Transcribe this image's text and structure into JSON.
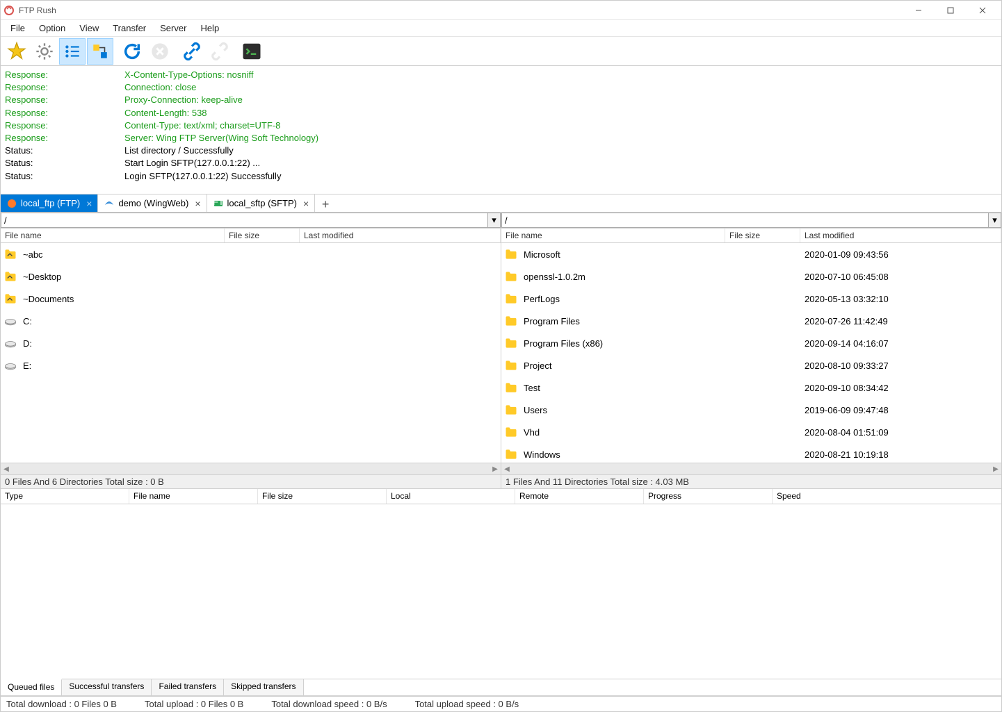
{
  "window": {
    "title": "FTP Rush"
  },
  "menu": [
    "File",
    "Option",
    "View",
    "Transfer",
    "Server",
    "Help"
  ],
  "log_lines": [
    {
      "cls": "green",
      "label": "Response:",
      "msg": "X-Content-Type-Options: nosniff"
    },
    {
      "cls": "green",
      "label": "Response:",
      "msg": "Connection: close"
    },
    {
      "cls": "green",
      "label": "Response:",
      "msg": "Proxy-Connection: keep-alive"
    },
    {
      "cls": "green",
      "label": "Response:",
      "msg": "Content-Length: 538"
    },
    {
      "cls": "green",
      "label": "Response:",
      "msg": "Content-Type: text/xml; charset=UTF-8"
    },
    {
      "cls": "green",
      "label": "Response:",
      "msg": "Server: Wing FTP Server(Wing Soft Technology)"
    },
    {
      "cls": "black",
      "label": "Status:",
      "msg": "List directory / Successfully"
    },
    {
      "cls": "black",
      "label": "Status:",
      "msg": "Start Login SFTP(127.0.0.1:22) ..."
    },
    {
      "cls": "black",
      "label": "Status:",
      "msg": "Login SFTP(127.0.0.1:22) Successfully"
    }
  ],
  "conn_tabs": {
    "items": [
      {
        "label": "local_ftp (FTP)",
        "active": true,
        "icon": "ftp"
      },
      {
        "label": "demo (WingWeb)",
        "active": false,
        "icon": "wing"
      },
      {
        "label": "local_sftp (SFTP)",
        "active": false,
        "icon": "sftp"
      }
    ]
  },
  "left_pane": {
    "path": "/",
    "headers": {
      "name": "File name",
      "size": "File size",
      "mod": "Last modified"
    },
    "rows": [
      {
        "icon": "link-folder",
        "name": "~abc",
        "size": "",
        "mod": ""
      },
      {
        "icon": "link-folder",
        "name": "~Desktop",
        "size": "",
        "mod": ""
      },
      {
        "icon": "link-folder",
        "name": "~Documents",
        "size": "",
        "mod": ""
      },
      {
        "icon": "drive",
        "name": "C:",
        "size": "",
        "mod": ""
      },
      {
        "icon": "drive",
        "name": "D:",
        "size": "",
        "mod": ""
      },
      {
        "icon": "drive",
        "name": "E:",
        "size": "",
        "mod": ""
      }
    ],
    "footer": "0 Files And 6 Directories Total size : 0 B"
  },
  "right_pane": {
    "path": "/",
    "headers": {
      "name": "File name",
      "size": "File size",
      "mod": "Last modified"
    },
    "rows": [
      {
        "icon": "folder",
        "name": "Microsoft",
        "size": "",
        "mod": "2020-01-09 09:43:56"
      },
      {
        "icon": "folder",
        "name": "openssl-1.0.2m",
        "size": "",
        "mod": "2020-07-10 06:45:08"
      },
      {
        "icon": "folder",
        "name": "PerfLogs",
        "size": "",
        "mod": "2020-05-13 03:32:10"
      },
      {
        "icon": "folder",
        "name": "Program Files",
        "size": "",
        "mod": "2020-07-26 11:42:49"
      },
      {
        "icon": "folder",
        "name": "Program Files (x86)",
        "size": "",
        "mod": "2020-09-14 04:16:07"
      },
      {
        "icon": "folder",
        "name": "Project",
        "size": "",
        "mod": "2020-08-10 09:33:27"
      },
      {
        "icon": "folder",
        "name": "Test",
        "size": "",
        "mod": "2020-09-10 08:34:42"
      },
      {
        "icon": "folder",
        "name": "Users",
        "size": "",
        "mod": "2019-06-09 09:47:48"
      },
      {
        "icon": "folder",
        "name": "Vhd",
        "size": "",
        "mod": "2020-08-04 01:51:09"
      },
      {
        "icon": "folder",
        "name": "Windows",
        "size": "",
        "mod": "2020-08-21 10:19:18"
      }
    ],
    "footer": "1 Files And 11 Directories Total size : 4.03 MB"
  },
  "queue": {
    "headers": {
      "type": "Type",
      "fname": "File name",
      "fsize": "File size",
      "local": "Local",
      "remote": "Remote",
      "prog": "Progress",
      "speed": "Speed"
    },
    "tabs": [
      "Queued files",
      "Successful transfers",
      "Failed transfers",
      "Skipped transfers"
    ]
  },
  "status": {
    "dl": "Total download : 0 Files  0 B",
    "ul": "Total upload : 0 Files  0 B",
    "dlspeed": "Total download speed : 0 B/s",
    "ulspeed": "Total upload speed : 0 B/s"
  }
}
